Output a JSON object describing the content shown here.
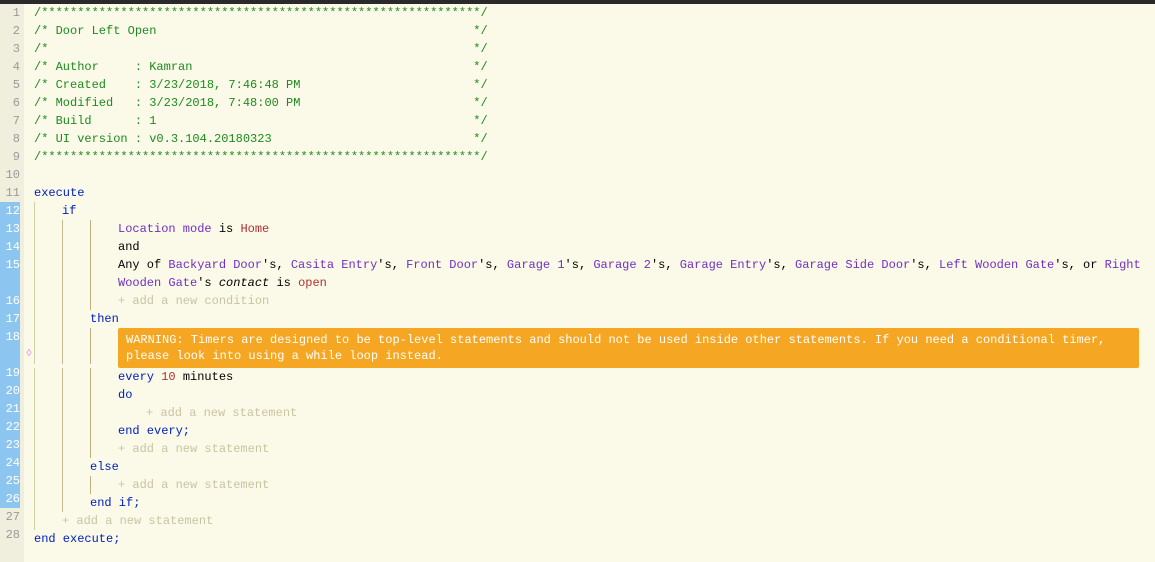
{
  "chart_data": null,
  "header": {
    "sep": "/*************************************************************/",
    "title": "/* Door Left Open                                            */",
    "blank": "/*                                                           */",
    "author": "/* Author     : Kamran                                       */",
    "created": "/* Created    : 3/23/2018, 7:46:48 PM                        */",
    "modified": "/* Modified   : 3/23/2018, 7:48:00 PM                        */",
    "build": "/* Build      : 1                                            */",
    "uiver": "/* UI version : v0.3.104.20180323                            */"
  },
  "kw": {
    "execute": "execute",
    "if": "if",
    "then": "then",
    "else": "else",
    "endif": "end if;",
    "endexecute": "end execute;",
    "every": "every",
    "do": "do",
    "endevery": "end every;"
  },
  "condition": {
    "location_mode": "Location mode",
    "is": " is ",
    "home": "Home",
    "and": "and",
    "anyof": "Any of ",
    "devices": [
      "Backyard Door",
      "Casita Entry",
      "Front Door",
      "Garage 1",
      "Garage 2",
      "Garage Entry",
      "Garage Side Door",
      "Left Wooden Gate",
      "Right Wooden Gate"
    ],
    "poss": "'s",
    "sep": ", ",
    "or": ", or ",
    "contact": "contact",
    "is2": " is ",
    "open": "open"
  },
  "timer": {
    "num": "10",
    "unit": " minutes"
  },
  "hints": {
    "add_cond": "+ add a new condition",
    "add_stmt": "+ add a new statement"
  },
  "warning": "WARNING: Timers are designed to be top-level statements and should not be used inside other statements. If you need a conditional timer, please look into using a while loop instead.",
  "lines": [
    1,
    2,
    3,
    4,
    5,
    6,
    7,
    8,
    9,
    10,
    11,
    12,
    13,
    14,
    15,
    16,
    17,
    18,
    19,
    20,
    21,
    22,
    23,
    24,
    25,
    26,
    27,
    28
  ],
  "hl": [
    12,
    13,
    14,
    15,
    16,
    17,
    18,
    19,
    20,
    21,
    22,
    23,
    24,
    25,
    26
  ]
}
